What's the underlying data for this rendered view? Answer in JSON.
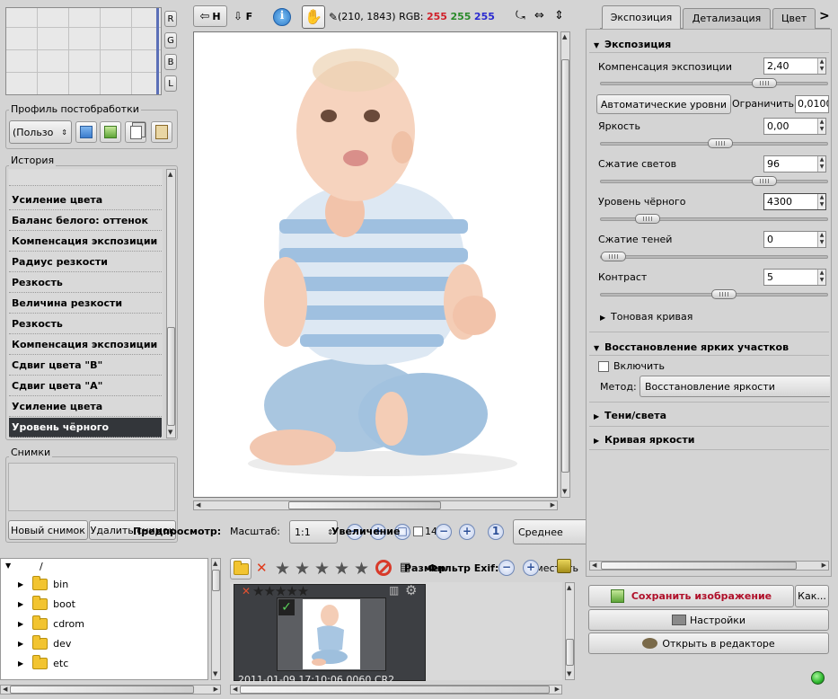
{
  "histogram": {
    "channel_buttons": [
      "R",
      "G",
      "B",
      "L"
    ]
  },
  "profile": {
    "title": "Профиль постобработки",
    "selected": "(Пользо"
  },
  "history": {
    "title": "История",
    "items": [
      "Усиление цвета",
      "Баланс белого: оттенок",
      "Компенсация экспозиции",
      "Радиус резкости",
      "Резкость",
      "Величина резкости",
      "Резкость",
      "Компенсация экспозиции",
      "Сдвиг цвета \"B\"",
      "Сдвиг цвета \"A\"",
      "Усиление цвета",
      "Уровень чёрного"
    ],
    "selected_index": 11
  },
  "snapshots": {
    "title": "Снимки",
    "new_label": "Новый снимок",
    "delete_label": "Удалить снимок"
  },
  "toolbar": {
    "h_label": "H",
    "f_label": "F",
    "coords": "(210, 1843) RGB:",
    "r_value": "255",
    "g_value": "255",
    "b_value": "255"
  },
  "colors": {
    "r": "#d0202a",
    "g": "#2a8a2a",
    "b": "#2a2ad0",
    "accent_save": "#b0102a",
    "status": "#2fb82f"
  },
  "bottom_toolbar": {
    "preview_label": "Предпросмотр:",
    "scale_label": "Масштаб:",
    "scale_value": "1:1",
    "zoom_label": "Увеличение",
    "check_value": "14",
    "quality_value": "Среднее"
  },
  "tabs": [
    "Экспозиция",
    "Детализация",
    "Цвет"
  ],
  "exposure": {
    "title": "Экспозиция",
    "comp_label": "Компенсация экспозиции",
    "comp_value": "2,40",
    "auto_levels": "Автоматические уровни",
    "clip_label": "Ограничить",
    "clip_value": "0,0100",
    "brightness_label": "Яркость",
    "brightness_value": "0,00",
    "highlight_label": "Сжатие светов",
    "highlight_value": "96",
    "black_label": "Уровень чёрного",
    "black_value": "4300",
    "shadow_label": "Сжатие теней",
    "shadow_value": "0",
    "contrast_label": "Контраст",
    "contrast_value": "5",
    "tone_curve_label": "Тоновая кривая"
  },
  "slider_levels": {
    "comp": 0.75,
    "brightness": 0.53,
    "highlight": 0.75,
    "black": 0.17,
    "shadow": 0.0,
    "contrast": 0.55
  },
  "recovery": {
    "title": "Восстановление ярких участков",
    "enable_label": "Включить",
    "method_label": "Метод:",
    "method_value": "Восстановление яркости"
  },
  "shadows_highlights": {
    "title": "Тени/света"
  },
  "lum_curve": {
    "title": "Кривая яркости"
  },
  "file_tree": {
    "root": "/",
    "folders": [
      "bin",
      "boot",
      "cdrom",
      "dev",
      "etc"
    ]
  },
  "filmstrip": {
    "size_label": "Размер",
    "filter_label": "Фильтр",
    "exif_label": "Exif:",
    "trash_label": "Переместить",
    "thumb_caption": "2011-01-09 17:10:06 0060.CR2"
  },
  "actions": {
    "save_label": "Сохранить изображение",
    "as_label": "Как...",
    "settings_label": "Настройки",
    "editor_label": "Открыть в редакторе"
  },
  "icons": [
    "prev-icon",
    "next-icon",
    "info-icon",
    "hand-icon",
    "eyedropper-icon",
    "rotate-icon",
    "flip-h-icon",
    "flip-v-icon",
    "folder-icon",
    "delete-icon",
    "star-icon",
    "reject-icon",
    "zoom-out-icon",
    "zoom-in-icon",
    "zoom-fit-icon",
    "save-icon",
    "settings-icon",
    "gimp-icon",
    "status-led-icon"
  ]
}
